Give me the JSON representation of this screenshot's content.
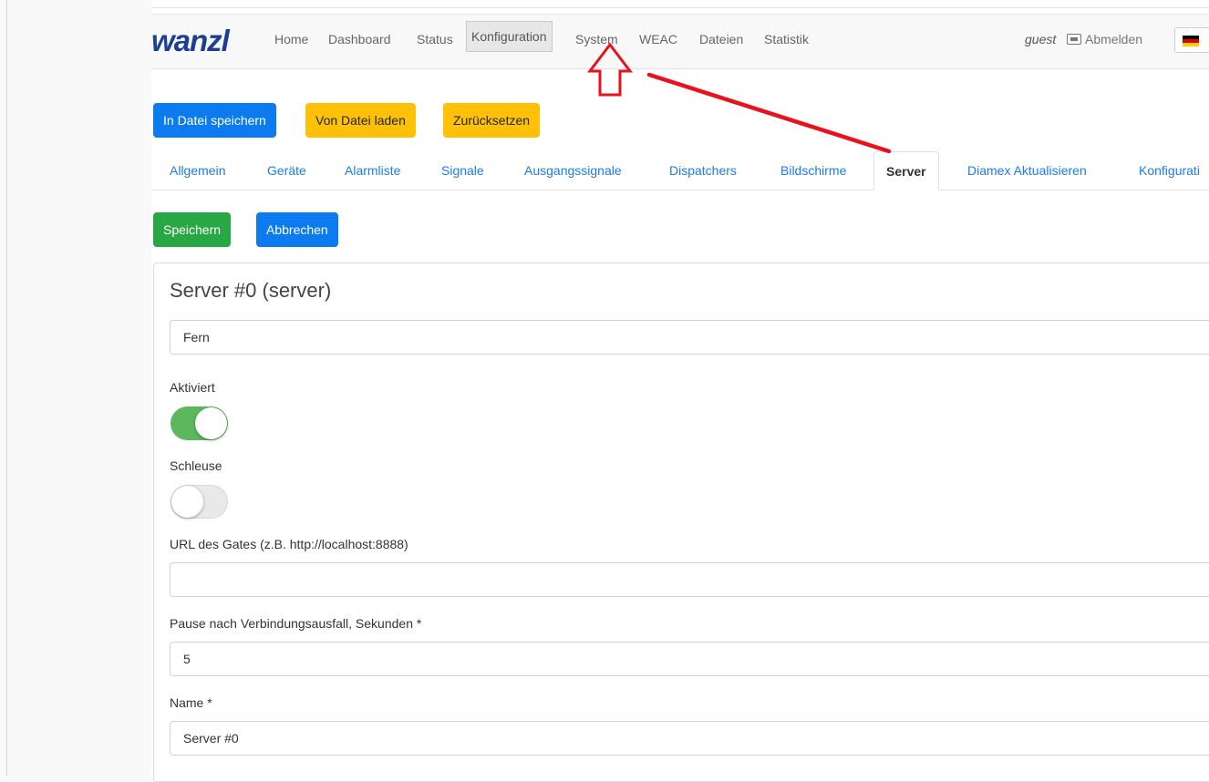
{
  "navbar": {
    "logo": "wanzl",
    "items": [
      "Home",
      "Dashboard",
      "Status",
      "Konfiguration",
      "System",
      "WEAC",
      "Dateien",
      "Statistik"
    ],
    "active_item": "Konfiguration",
    "user": "guest",
    "logout_label": "Abmelden"
  },
  "actions": {
    "save_to_file": "In Datei speichern",
    "load_from_file": "Von Datei laden",
    "reset": "Zurücksetzen"
  },
  "tabs": [
    "Allgemein",
    "Geräte",
    "Alarmliste",
    "Signale",
    "Ausgangssignale",
    "Dispatchers",
    "Bildschirme",
    "Server",
    "Diamex Aktualisieren",
    "Konfigurati"
  ],
  "active_tab": "Server",
  "form_actions": {
    "save": "Speichern",
    "cancel": "Abbrechen"
  },
  "server": {
    "title": "Server #0 (server)",
    "type_value": "Fern",
    "enabled_label": "Aktiviert",
    "enabled": true,
    "gate_label": "Schleuse",
    "gate": false,
    "url_label": "URL des Gates (z.B. http://localhost:8888)",
    "url_value": "",
    "pause_label": "Pause nach Verbindungsausfall, Sekunden *",
    "pause_value": "5",
    "name_label": "Name *",
    "name_value": "Server #0"
  },
  "colors": {
    "primary": "#0d7bf0",
    "warning": "#fec107",
    "success": "#28a745",
    "toggle_on": "#5cb85c",
    "logo": "#1c3f94",
    "annotation": "#e8121c"
  },
  "icons": [
    "logout-icon",
    "german-flag-icon",
    "arrow-up-annotation",
    "arrow-line-annotation"
  ]
}
